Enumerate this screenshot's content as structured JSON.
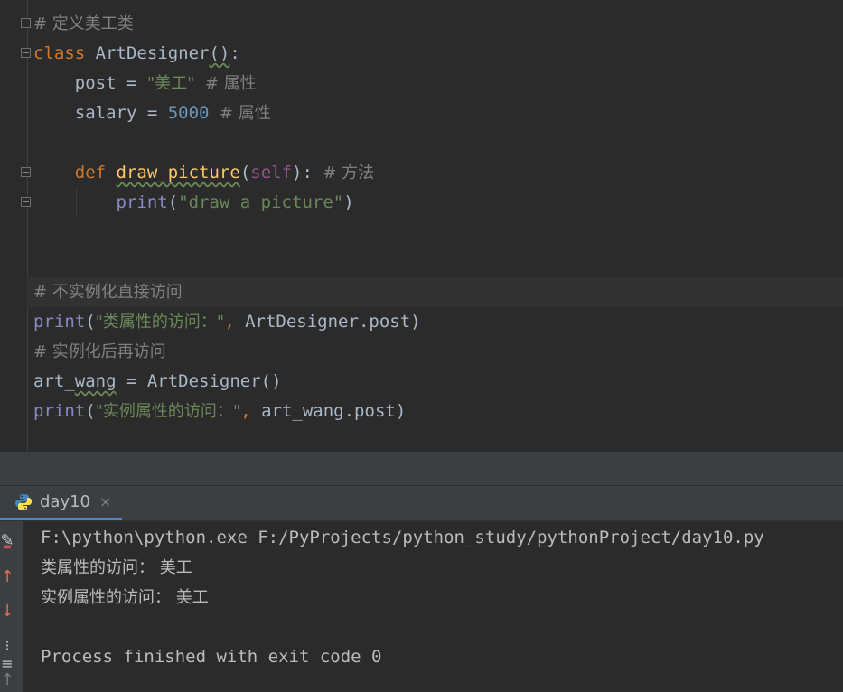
{
  "editor": {
    "lines": [
      {
        "tokens": [
          {
            "t": "# 定义美工类",
            "c": "cm cjk"
          }
        ]
      },
      {
        "tokens": [
          {
            "t": "class",
            "c": "kw"
          },
          {
            "t": " ArtDesigner",
            "c": ""
          },
          {
            "t": "()",
            "c": "typo"
          },
          {
            "t": ":",
            "c": ""
          }
        ]
      },
      {
        "tokens": [
          {
            "t": "    post = ",
            "c": ""
          },
          {
            "t": "\"美工\"",
            "c": "str cjk"
          },
          {
            "t": "  # 属性",
            "c": "cm cjk"
          }
        ]
      },
      {
        "tokens": [
          {
            "t": "    salary = ",
            "c": ""
          },
          {
            "t": "5000",
            "c": "num"
          },
          {
            "t": "  # 属性",
            "c": "cm cjk"
          }
        ]
      },
      {
        "tokens": []
      },
      {
        "tokens": [
          {
            "t": "    ",
            "c": ""
          },
          {
            "t": "def",
            "c": "kw"
          },
          {
            "t": " ",
            "c": ""
          },
          {
            "t": "draw_picture",
            "c": "fn"
          },
          {
            "t": "(",
            "c": ""
          },
          {
            "t": "self",
            "c": "selfc"
          },
          {
            "t": "):",
            "c": ""
          },
          {
            "t": "  # 方法",
            "c": "cm cjk"
          }
        ]
      },
      {
        "tokens": [
          {
            "t": "        ",
            "c": ""
          },
          {
            "t": "print",
            "c": "bi"
          },
          {
            "t": "(",
            "c": ""
          },
          {
            "t": "\"draw a picture\"",
            "c": "str"
          },
          {
            "t": ")",
            "c": ""
          }
        ]
      },
      {
        "tokens": []
      },
      {
        "tokens": []
      },
      {
        "tokens": [
          {
            "t": "# 不实例化直接访问",
            "c": "cm cjk"
          }
        ]
      },
      {
        "tokens": [
          {
            "t": "print",
            "c": "bi"
          },
          {
            "t": "(",
            "c": ""
          },
          {
            "t": "\"类属性的访问：\"",
            "c": "str cjk"
          },
          {
            "t": ", ",
            "c": "kw"
          },
          {
            "t": "ArtDesigner.post)",
            "c": ""
          }
        ]
      },
      {
        "tokens": [
          {
            "t": "# 实例化后再访问",
            "c": "cm cjk"
          }
        ]
      },
      {
        "tokens": [
          {
            "t": "art_",
            "c": ""
          },
          {
            "t": "wang",
            "c": "typo"
          },
          {
            "t": " = ArtDesigner()",
            "c": ""
          }
        ]
      },
      {
        "tokens": [
          {
            "t": "print",
            "c": "bi"
          },
          {
            "t": "(",
            "c": ""
          },
          {
            "t": "\"实例属性的访问：\"",
            "c": "str cjk"
          },
          {
            "t": ", ",
            "c": "kw"
          },
          {
            "t": "art_wang.post)",
            "c": ""
          }
        ]
      }
    ]
  },
  "run_tab": {
    "label": "day10",
    "close": "×",
    "icon": "python-icon"
  },
  "console": {
    "lines": [
      "F:\\python\\python.exe F:/PyProjects/python_study/pythonProject/day10.py",
      "类属性的访问： 美工",
      "实例属性的访问： 美工",
      "",
      "Process finished with exit code 0"
    ]
  },
  "colors": {
    "background": "#2b2b2b",
    "keyword": "#cc7832",
    "string": "#6a8759",
    "number": "#6897bb",
    "comment": "#808080",
    "function": "#ffc66d",
    "builtin": "#8888c6",
    "self": "#94558d"
  }
}
